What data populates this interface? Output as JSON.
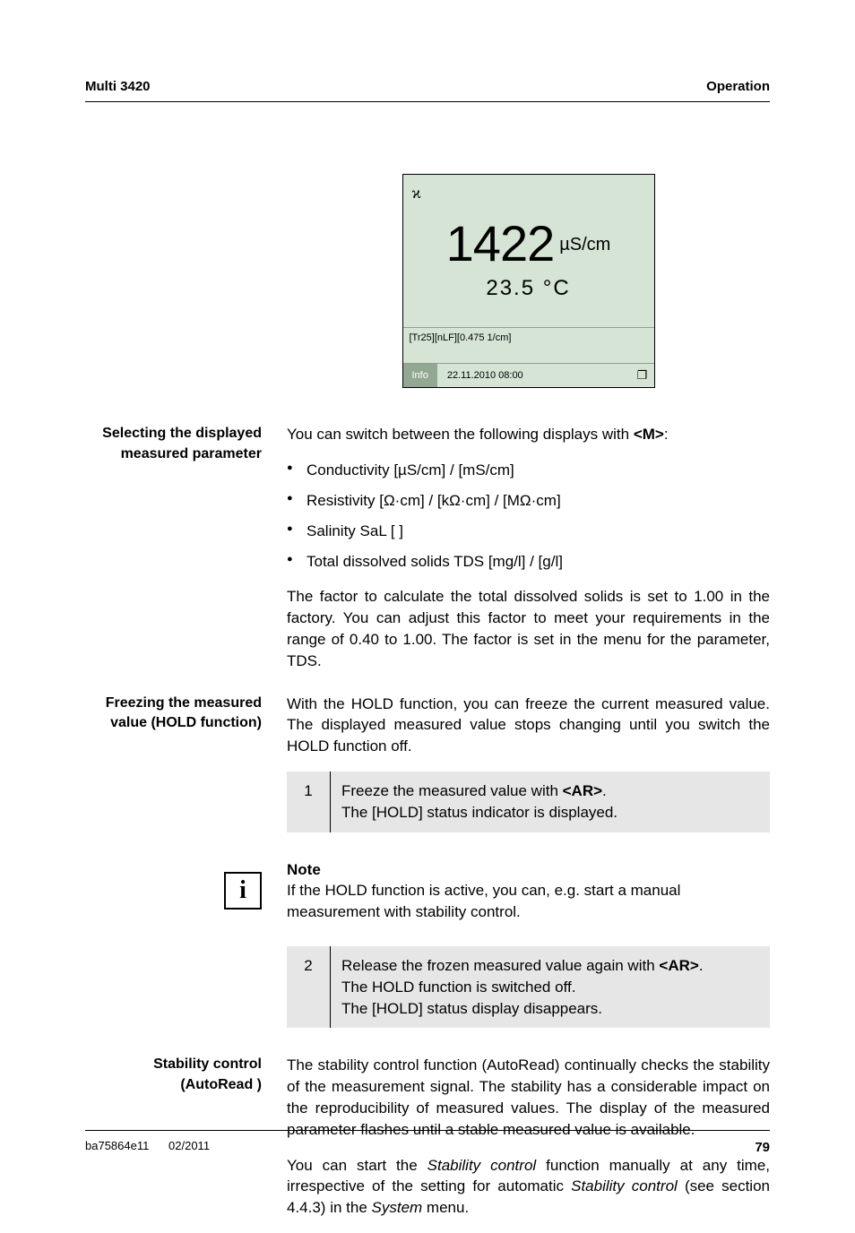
{
  "header": {
    "left": "Multi 3420",
    "right": "Operation"
  },
  "lcd": {
    "symbol": "ϰ",
    "value": "1422",
    "unit": "µS/cm",
    "temp": "23.5 °C",
    "status_line": "[Tr25][nLF][0.475 1/cm]",
    "info_btn": "Info",
    "datetime": "22.11.2010 08:00",
    "corner_icon": "❐"
  },
  "sections": {
    "select": {
      "label": "Selecting the displayed measured parameter",
      "intro_pre": "You can switch between the following displays with ",
      "intro_key": "<M>",
      "intro_post": ":",
      "bullets": [
        "Conductivity [µS/cm] / [mS/cm]",
        "Resistivity [Ω·cm] / [kΩ·cm] / [MΩ·cm]",
        "Salinity SaL [ ]",
        "Total dissolved solids TDS [mg/l] / [g/l]"
      ],
      "para": "The factor to calculate the total dissolved solids is set to 1.00 in the factory. You can adjust this factor to meet your requirements in the range of 0.40 to 1.00. The factor is set in the menu for the parameter, TDS."
    },
    "hold": {
      "label": "Freezing the measured value (HOLD function)",
      "para": "With the HOLD function, you can freeze the current measured value. The displayed measured value stops changing until you switch the HOLD function off.",
      "step1_num": "1",
      "step1_a": "Freeze the measured value with ",
      "step1_key": "<AR>",
      "step1_b": ".",
      "step1_c": "The [HOLD] status indicator is displayed.",
      "note_head": "Note",
      "note_body": "If the HOLD function is active, you can, e.g. start a manual measurement with stability control.",
      "step2_num": "2",
      "step2_a": "Release the frozen measured value again with ",
      "step2_key": "<AR>",
      "step2_b": ".",
      "step2_c": "The HOLD function is switched off.",
      "step2_d": "The [HOLD] status display disappears."
    },
    "auto": {
      "label": "Stability control (AutoRead )",
      "para1": "The stability control function (AutoRead) continually checks the stability of the measurement signal. The stability has a considerable impact on the reproducibility of measured values. The display of the measured parameter flashes until a stable measured value is available.",
      "p2_a": "You can start the ",
      "p2_em1": "Stability control",
      "p2_b": " function manually at any time, irrespective of the setting for automatic ",
      "p2_em2": "Stability control",
      "p2_c": " (see section 4.4.3) in the ",
      "p2_em3": "System",
      "p2_d": " menu."
    }
  },
  "footer": {
    "left1": "ba75864e11",
    "left2": "02/2011",
    "page": "79"
  },
  "info_glyph": "i"
}
